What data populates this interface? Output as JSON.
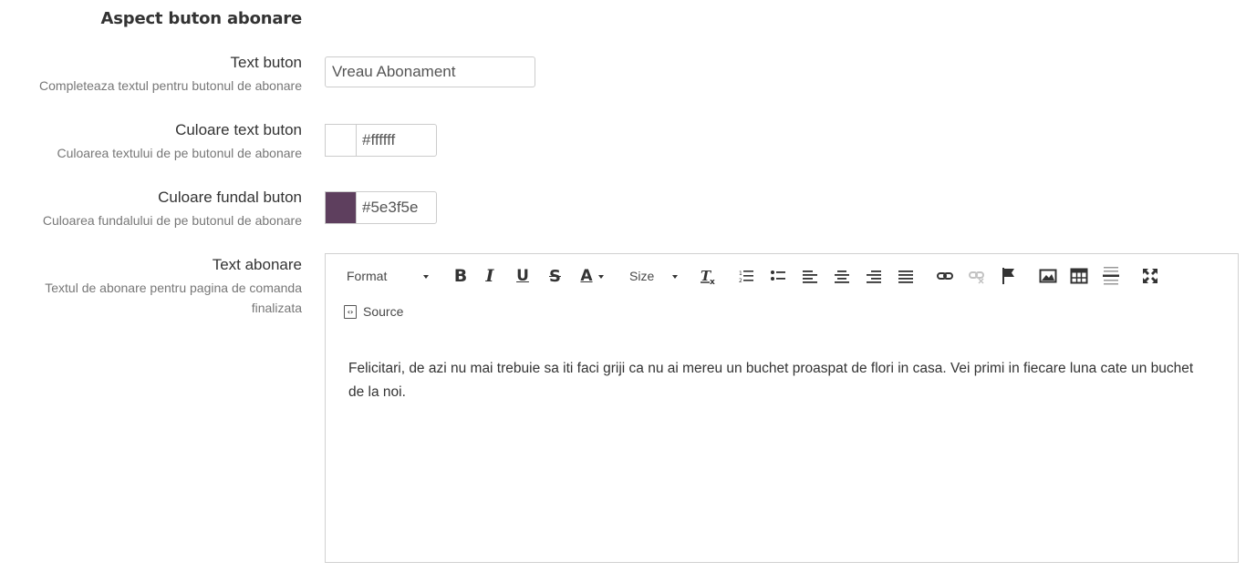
{
  "section": {
    "title": "Aspect buton abonare"
  },
  "fields": {
    "button_text": {
      "label": "Text buton",
      "help": "Completeaza textul pentru butonul de abonare",
      "value": "Vreau Abonament"
    },
    "button_text_color": {
      "label": "Culoare text buton",
      "help": "Culoarea textului de pe butonul de abonare",
      "value": "#ffffff",
      "swatch": "#ffffff"
    },
    "button_bg_color": {
      "label": "Culoare fundal buton",
      "help": "Culoarea fundalului de pe butonul de abonare",
      "value": "#5e3f5e",
      "swatch": "#5e3f5e"
    },
    "subscribe_text": {
      "label": "Text abonare",
      "help": "Textul de abonare pentru pagina de comanda finalizata"
    }
  },
  "editor": {
    "format_label": "Format",
    "size_label": "Size",
    "source_label": "Source",
    "content": "Felicitari, de azi nu mai trebuie sa iti faci griji ca nu ai mereu un buchet proaspat de flori in casa. Vei primi in fiecare luna cate un buchet de la noi.",
    "toolbar_icons": [
      "bold-icon",
      "italic-icon",
      "underline-icon",
      "strikethrough-icon",
      "text-color-icon",
      "remove-format-icon",
      "numbered-list-icon",
      "bulleted-list-icon",
      "align-left-icon",
      "align-center-icon",
      "align-right-icon",
      "align-justify-icon",
      "link-icon",
      "unlink-icon",
      "anchor-icon",
      "image-icon",
      "table-icon",
      "horizontal-line-icon",
      "maximize-icon",
      "source-icon"
    ]
  }
}
